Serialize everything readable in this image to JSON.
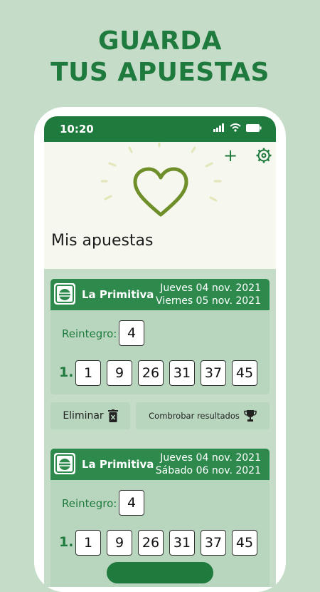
{
  "headline": {
    "line1": "GUARDA",
    "line2": "TUS APUESTAS"
  },
  "status": {
    "time": "10:20"
  },
  "hero": {
    "title": "Mis apuestas",
    "heart_icon": "heart-icon"
  },
  "bets": [
    {
      "game": "La Primitiva",
      "date1": "Jueves 04 nov. 2021",
      "date2": "Viernes 05 nov. 2021",
      "reintegro_label": "Reintegro:",
      "reintegro": "4",
      "row_label": "1.",
      "numbers": [
        "1",
        "9",
        "26",
        "31",
        "37",
        "45"
      ]
    },
    {
      "game": "La Primitiva",
      "date1": "Jueves 04 nov. 2021",
      "date2": "Sábado 06 nov. 2021",
      "reintegro_label": "Reintegro:",
      "reintegro": "4",
      "row_label": "1.",
      "numbers": [
        "1",
        "9",
        "26",
        "31",
        "37",
        "45"
      ]
    }
  ],
  "actions": {
    "delete_label": "Eliminar",
    "check_label": "Combrobar resultados"
  },
  "colors": {
    "brand": "#1f7a3e",
    "card": "#b8d6bd",
    "background": "#c5dcc8"
  }
}
